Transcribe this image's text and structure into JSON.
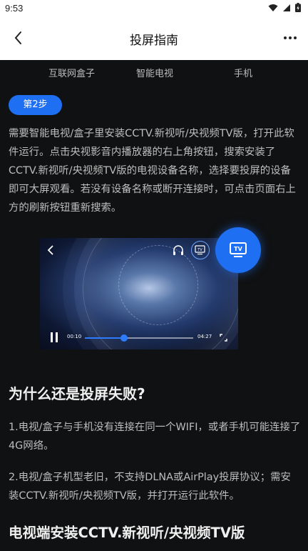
{
  "status": {
    "time": "9:53"
  },
  "header": {
    "title": "投屏指南"
  },
  "tabs": [
    "互联网盒子",
    "智能电视",
    "手机"
  ],
  "step": {
    "label": "第2步"
  },
  "instructions": "需要智能电视/盒子里安装CCTV.新视听/央视频TV版，打开此软件运行。点击央视影音内播放器的右上角按钮，搜索安装了CCTV.新视听/央视频TV版的电视设备名称，选择要投屏的设备即可大屏观看。若没有设备名称或断开连接时，可点击页面右上方的刷新按钮重新搜索。",
  "player": {
    "elapsed": "00:10",
    "duration": "04:27",
    "progress_fraction": 0.36,
    "tv_badge": "TV"
  },
  "faq": {
    "title": "为什么还是投屏失败?",
    "reason1": "1.电视/盒子与手机没有连接在同一个WIFI，或者手机可能连接了4G网络。",
    "reason2": "2.电视/盒子机型老旧，不支持DLNA或AirPlay投屏协议；需安装CCTV.新视听/央视频TV版，并打开运行此软件。"
  },
  "install_title": "电视端安装CCTV.新视听/央视频TV版",
  "colors": {
    "accent": "#1f6ff2",
    "background": "#101112"
  }
}
